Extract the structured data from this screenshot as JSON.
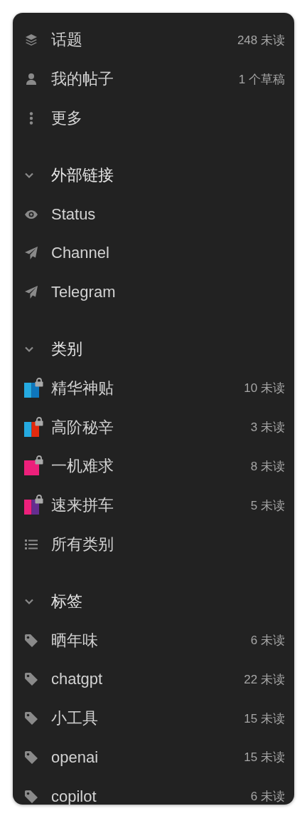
{
  "primary_links": [
    {
      "kind": "layers",
      "label": "话题",
      "badge": "248 未读"
    },
    {
      "kind": "user",
      "label": "我的帖子",
      "badge": "1 个草稿"
    },
    {
      "kind": "more",
      "label": "更多"
    }
  ],
  "sections": [
    {
      "title": "外部链接",
      "expanded": true,
      "items": [
        {
          "kind": "eye",
          "label": "Status"
        },
        {
          "kind": "send",
          "label": "Channel"
        },
        {
          "kind": "send",
          "label": "Telegram"
        }
      ]
    },
    {
      "title": "类别",
      "expanded": true,
      "items": [
        {
          "kind": "category",
          "label": "精华神贴",
          "badge": "10 未读",
          "locked": true,
          "swatch": [
            {
              "color": "#25aae1"
            },
            {
              "color": "#0e76bd"
            }
          ]
        },
        {
          "kind": "category",
          "label": "高阶秘辛",
          "badge": "3 未读",
          "locked": true,
          "swatch": [
            {
              "color": "#25aae1"
            },
            {
              "color": "#e32a0e"
            }
          ]
        },
        {
          "kind": "category",
          "label": "一机难求",
          "badge": "8 未读",
          "locked": true,
          "swatch": [
            {
              "color": "#ed207b"
            }
          ]
        },
        {
          "kind": "category",
          "label": "速来拼车",
          "badge": "5 未读",
          "locked": true,
          "swatch": [
            {
              "color": "#ed207b"
            },
            {
              "color": "#652d90"
            }
          ]
        },
        {
          "kind": "list",
          "label": "所有类别"
        }
      ]
    },
    {
      "title": "标签",
      "expanded": true,
      "items": [
        {
          "kind": "tag",
          "label": "晒年味",
          "badge": "6 未读"
        },
        {
          "kind": "tag",
          "label": "chatgpt",
          "badge": "22 未读"
        },
        {
          "kind": "tag",
          "label": "小工具",
          "badge": "15 未读"
        },
        {
          "kind": "tag",
          "label": "openai",
          "badge": "15 未读"
        },
        {
          "kind": "tag",
          "label": "copilot",
          "badge": "6 未读"
        }
      ]
    }
  ]
}
